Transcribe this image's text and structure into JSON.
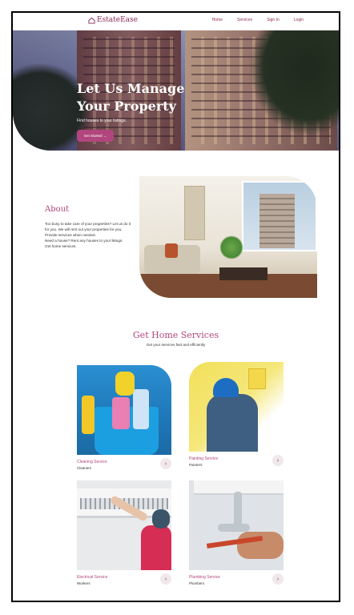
{
  "nav": {
    "brand": "EstateEase",
    "links": [
      "Home",
      "Services",
      "Sign In",
      "Login"
    ]
  },
  "hero": {
    "title": "Let Us Manage Your Property",
    "subtitle": "Find houses to your listings.",
    "button_label": "Get Started →"
  },
  "about": {
    "title": "About",
    "lines": [
      "Too busy to take care of your properties? Let us do it for you. We will rent out your properties for you. Provide services when needed.",
      "Need a house? Rent any houses to your likings.",
      "Get home services."
    ]
  },
  "services": {
    "title": "Get Home Services",
    "subtitle": "Get your services fast and efficiently",
    "cards": [
      {
        "name": "Cleaning Service",
        "role": "Cleaners"
      },
      {
        "name": "Painting Service",
        "role": "Painters"
      },
      {
        "name": "Electrical Service",
        "role": "Workers"
      },
      {
        "name": "Plumbing Service",
        "role": "Plumbers"
      }
    ]
  },
  "colors": {
    "accent": "#b0467d",
    "brand": "#8c2a55"
  }
}
